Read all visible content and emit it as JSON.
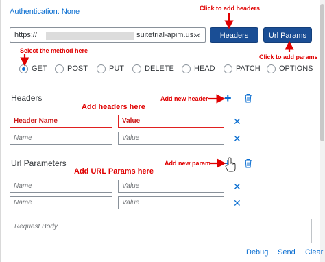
{
  "auth": {
    "label": "Authentication: None"
  },
  "request": {
    "url_prefix": "https://",
    "url_suffix": "suitetrial-apim.us...",
    "headers_button": "Headers",
    "urlparams_button": "Url Params"
  },
  "methods": {
    "options": [
      "GET",
      "POST",
      "PUT",
      "DELETE",
      "HEAD",
      "PATCH",
      "OPTIONS"
    ],
    "selected": "GET"
  },
  "headers": {
    "title": "Headers",
    "rows": [
      {
        "name": "Header Name",
        "value": "Value"
      },
      {
        "name_placeholder": "Name",
        "value_placeholder": "Value"
      }
    ]
  },
  "url_params": {
    "title": "Url Parameters",
    "rows": [
      {
        "name_placeholder": "Name",
        "value_placeholder": "Value"
      },
      {
        "name_placeholder": "Name",
        "value_placeholder": "Value"
      }
    ]
  },
  "body": {
    "placeholder": "Request Body"
  },
  "footer": {
    "debug": "Debug",
    "send": "Send",
    "clear": "Clear"
  },
  "annotations": {
    "click_headers": "Click to add headers",
    "select_method": "Select the method here",
    "click_params": "Click to add params",
    "add_new_header": "Add new header",
    "add_headers_here": "Add headers here",
    "add_new_param": "Add new param",
    "add_url_params_here": "Add URL Params here"
  },
  "colors": {
    "accent": "#0a6ed1",
    "button_bg": "#1a4e95",
    "annotation": "#e00000"
  }
}
